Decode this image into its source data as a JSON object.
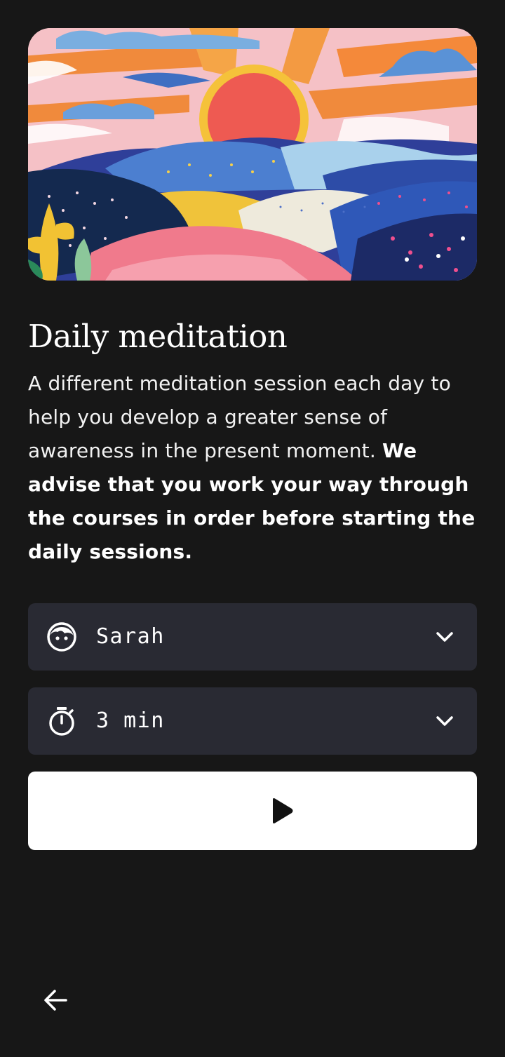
{
  "header": {
    "title": "Daily meditation"
  },
  "description": {
    "normal": "A different meditation session each day to help you develop a greater sense of awareness in the present moment. ",
    "bold": "We advise that you work your way through the courses in order before starting the daily sessions."
  },
  "voice_select": {
    "value": "Sarah",
    "icon": "face-icon"
  },
  "duration_select": {
    "value": "3 min",
    "icon": "stopwatch-icon"
  },
  "actions": {
    "play_icon": "play-icon",
    "back_icon": "arrow-left-icon"
  },
  "colors": {
    "background": "#171717",
    "select_background": "#292a33",
    "play_button": "#ffffff"
  }
}
